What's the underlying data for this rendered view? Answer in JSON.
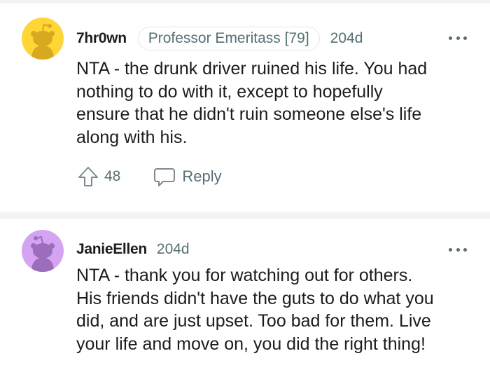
{
  "comments": [
    {
      "username": "7hr0wn",
      "flair": "Professor Emeritass [79]",
      "age": "204d",
      "body_lines": [
        "NTA - the drunk driver ruined his life. You had",
        "nothing to do with it, except to hopefully",
        "ensure that he didn't ruin someone else's life",
        "along with his."
      ],
      "score": "48",
      "reply_label": "Reply",
      "avatar_color": "#ffd635"
    },
    {
      "username": "JanieEllen",
      "age": "204d",
      "body_lines": [
        "NTA - thank you for watching out for others.",
        "His friends didn't have the guts to do what you",
        "did, and are just upset. Too bad for them. Live",
        "your life and move on, you did the right thing!"
      ],
      "avatar_color": "#d4a4f2"
    }
  ],
  "icons": [
    "snoo-avatar-icon",
    "more-options-icon",
    "upvote-arrow-icon",
    "reply-bubble-icon"
  ]
}
